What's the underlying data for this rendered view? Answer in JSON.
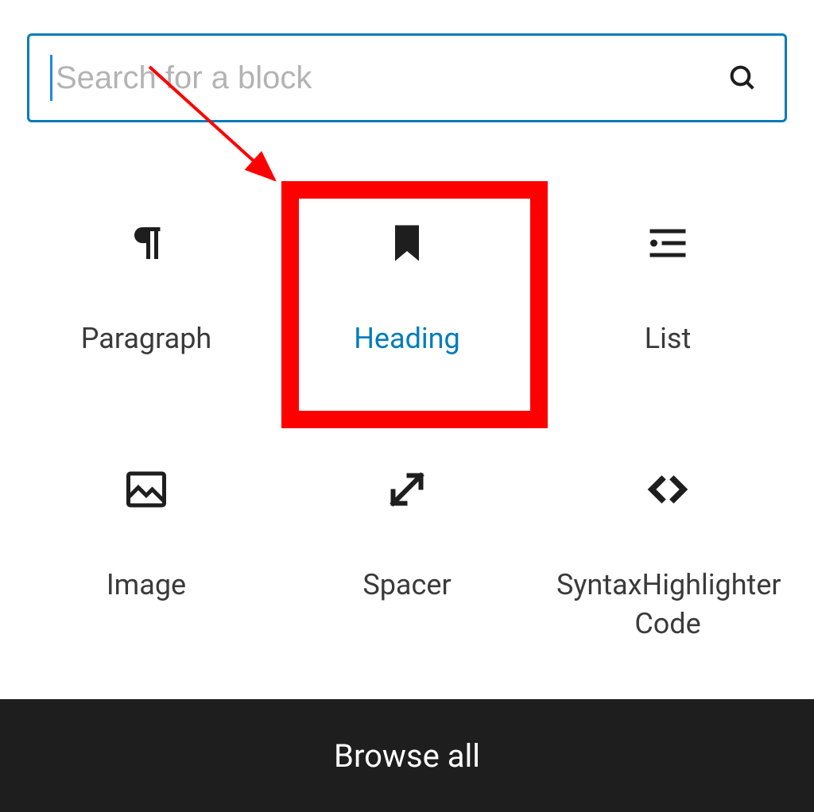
{
  "search": {
    "placeholder": "Search for a block",
    "value": "",
    "icon": "search-icon"
  },
  "blocks": [
    {
      "id": "paragraph",
      "label": "Paragraph",
      "icon": "pilcrow-icon",
      "highlighted": false
    },
    {
      "id": "heading",
      "label": "Heading",
      "icon": "bookmark-icon",
      "highlighted": true
    },
    {
      "id": "list",
      "label": "List",
      "icon": "list-icon",
      "highlighted": false
    },
    {
      "id": "image",
      "label": "Image",
      "icon": "image-icon",
      "highlighted": false
    },
    {
      "id": "spacer",
      "label": "Spacer",
      "icon": "resize-icon",
      "highlighted": false
    },
    {
      "id": "syntax-highlighter",
      "label": "SyntaxHighlighter Code",
      "icon": "code-icon",
      "highlighted": false
    }
  ],
  "footer": {
    "browse_all_label": "Browse all"
  },
  "annotations": {
    "highlight_box": {
      "target_block_id": "heading",
      "color": "#ff0000"
    },
    "arrow": {
      "from": "search-input",
      "to": "heading",
      "color": "#ff0000"
    }
  }
}
